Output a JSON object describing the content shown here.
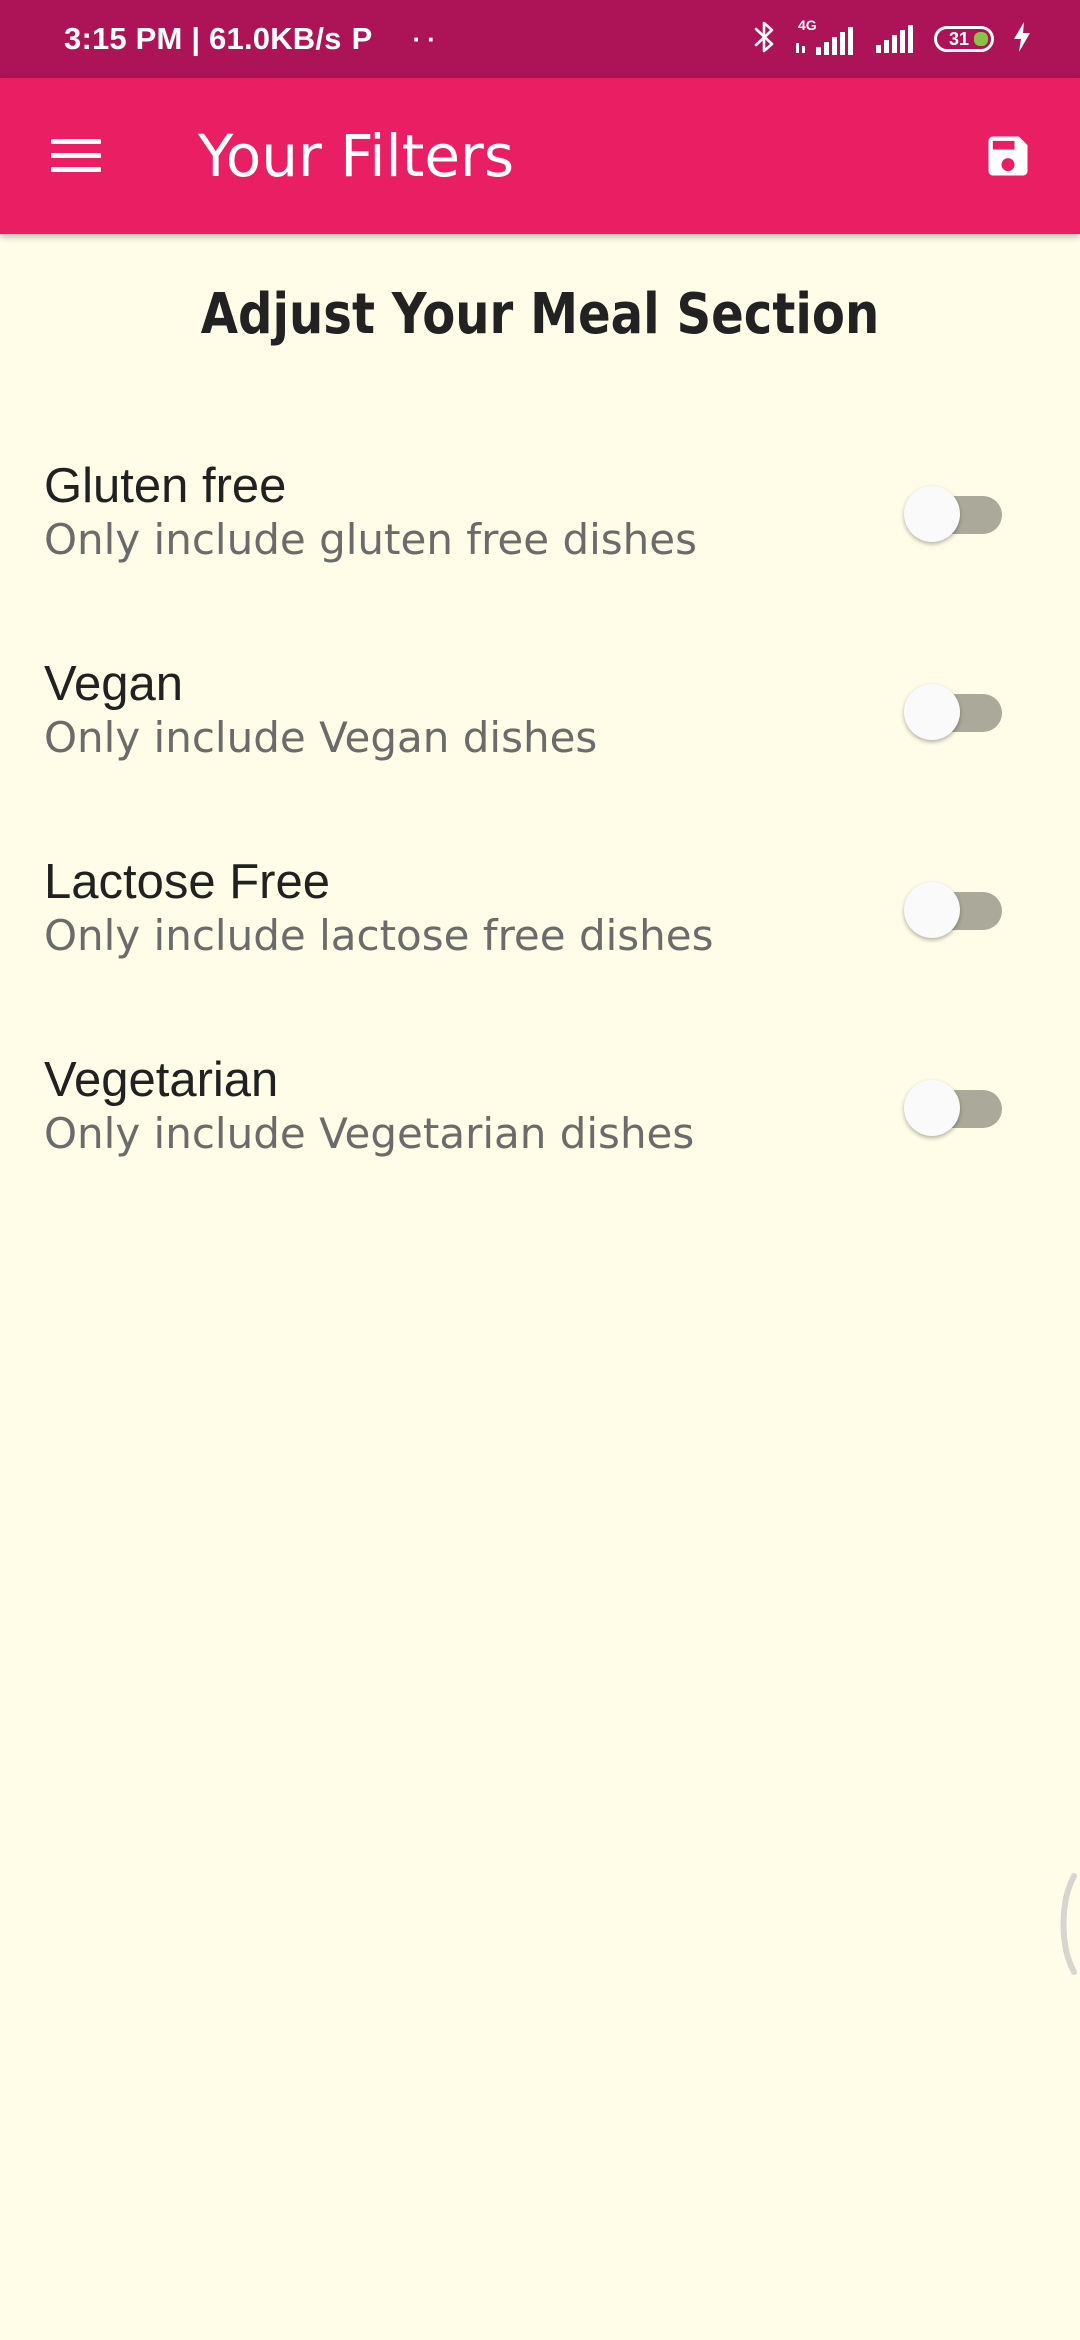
{
  "status_bar": {
    "time_speed": "3:15 PM | 61.0KB/s",
    "p_icon": "P",
    "dots": "··",
    "network_label": "4G",
    "battery_level": "31"
  },
  "app_bar": {
    "title": "Your Filters",
    "menu_icon": "hamburger-menu-icon",
    "save_icon": "floppy-disk-save-icon"
  },
  "content": {
    "section_title": "Adjust Your Meal Section",
    "filters": [
      {
        "title": "Gluten free",
        "subtitle": "Only include gluten free dishes",
        "enabled": false
      },
      {
        "title": "Vegan",
        "subtitle": "Only include Vegan dishes",
        "enabled": false
      },
      {
        "title": "Lactose Free",
        "subtitle": "Only include lactose free dishes",
        "enabled": false
      },
      {
        "title": "Vegetarian",
        "subtitle": "Only include Vegetarian dishes",
        "enabled": false
      }
    ]
  },
  "colors": {
    "status_bar": "#AD1457",
    "app_bar": "#E91E63",
    "background": "#FFFDE7",
    "switch_track_off": "#ABA99A",
    "switch_thumb_off": "#FAFAFA",
    "battery_fill": "#8BC34A"
  }
}
